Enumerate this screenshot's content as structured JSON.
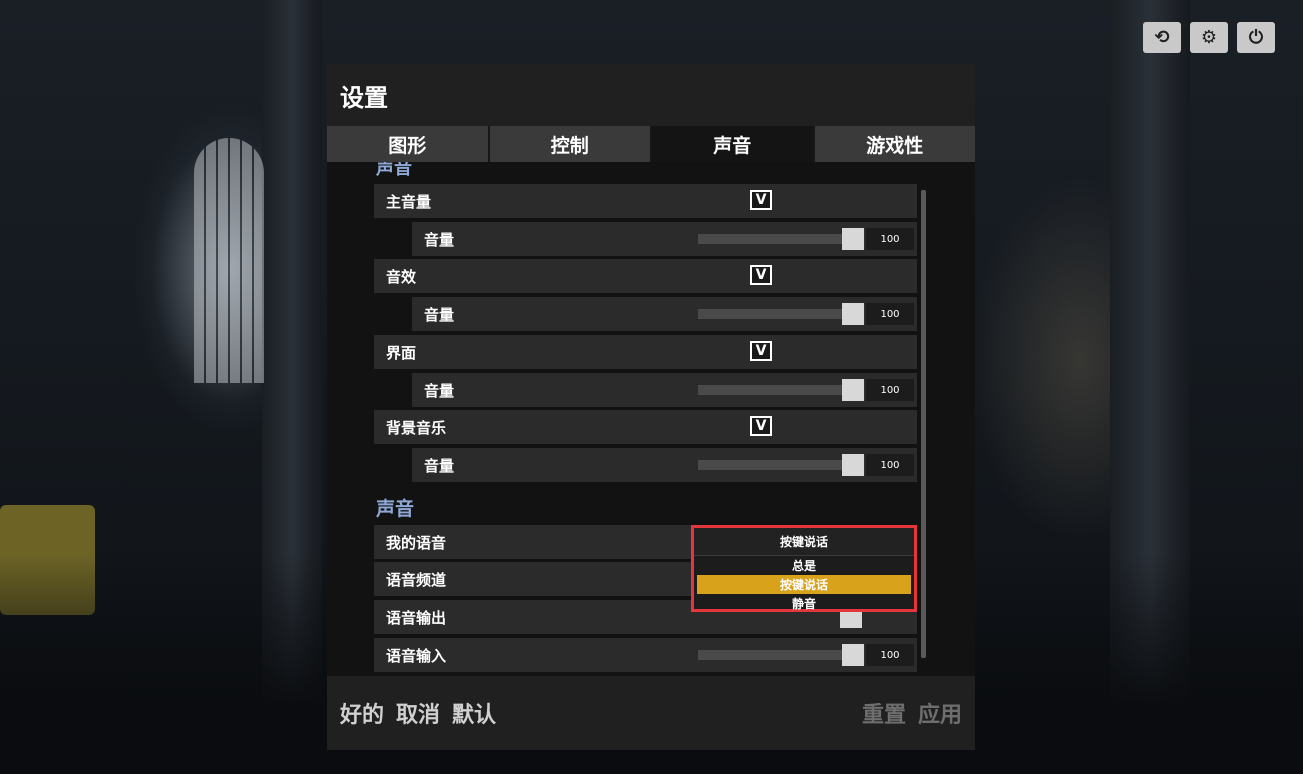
{
  "topbar": {
    "buttons": [
      {
        "name": "refresh-icon",
        "glyph": "⟲"
      },
      {
        "name": "gear-icon",
        "glyph": "⚙"
      },
      {
        "name": "power-icon",
        "glyph": "⏻"
      }
    ]
  },
  "panel": {
    "title": "设置"
  },
  "tabs": [
    {
      "label": "图形",
      "active": false
    },
    {
      "label": "控制",
      "active": false
    },
    {
      "label": "声音",
      "active": true
    },
    {
      "label": "游戏性",
      "active": false
    }
  ],
  "sound": {
    "cutoff_header": "声音",
    "rows": [
      {
        "label": "主音量",
        "checked": true,
        "volume_label": "音量",
        "volume": 100
      },
      {
        "label": "音效",
        "checked": true,
        "volume_label": "音量",
        "volume": 100
      },
      {
        "label": "界面",
        "checked": true,
        "volume_label": "音量",
        "volume": 100
      },
      {
        "label": "背景音乐",
        "checked": true,
        "volume_label": "音量",
        "volume": 100
      }
    ],
    "check_glyph": "V"
  },
  "voice": {
    "section_header": "声音",
    "my_voice_label": "我的语音",
    "voice_channel_label": "语音频道",
    "voice_output_label": "语音输出",
    "voice_input_label": "语音输入",
    "voice_input_volume": 100,
    "dropdown": {
      "selected": "按键说话",
      "options": [
        "总是",
        "按键说话",
        "静音"
      ],
      "highlighted": "按键说话"
    }
  },
  "footer": {
    "ok": "好的",
    "cancel": "取消",
    "default": "默认",
    "reset": "重置",
    "apply": "应用"
  },
  "colors": {
    "highlight": "#d9a21b",
    "outline": "#e4363c",
    "section": "#8ea9d6"
  }
}
